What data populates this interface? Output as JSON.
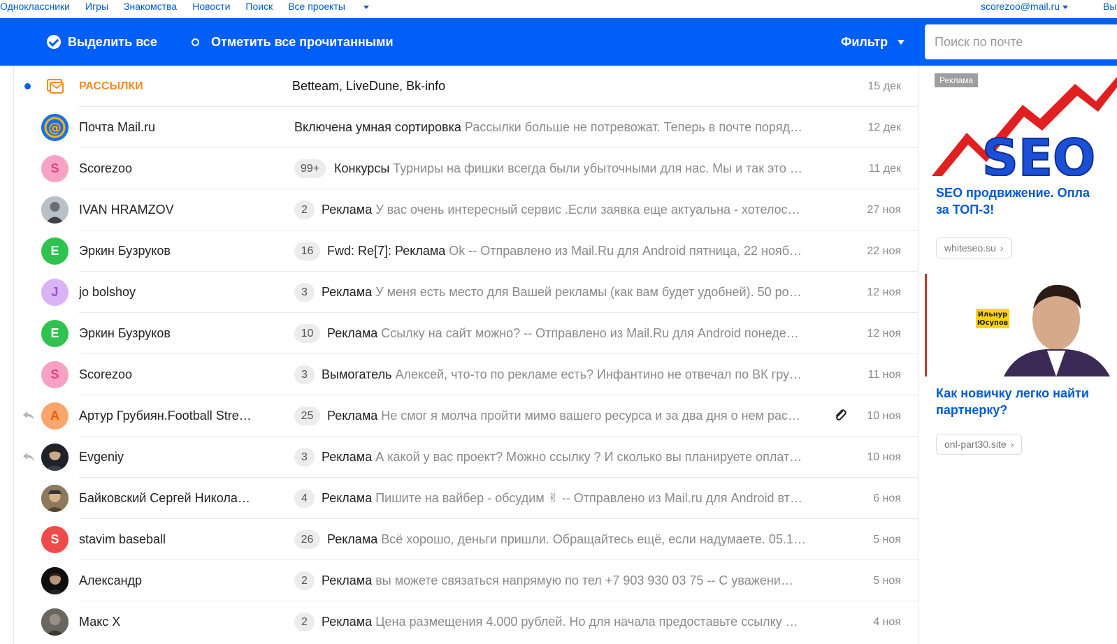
{
  "topnav": {
    "links": [
      "Одноклассники",
      "Игры",
      "Знакомства",
      "Новости",
      "Поиск",
      "Все проекты"
    ],
    "account": "scorezoo@mail.ru",
    "exit": "Выход"
  },
  "toolbar": {
    "select_all": "Выделить все",
    "mark_read": "Отметить все прочитанными",
    "filter": "Фильтр",
    "search_placeholder": "Поиск по почте"
  },
  "messages": [
    {
      "sender": "РАССЫЛКИ",
      "subject": "Betteam, LiveDune, Bk-info",
      "preview": "",
      "date": "15 дек",
      "count": "",
      "avatar": "mailing-icon"
    },
    {
      "sender": "Почта Mail.ru",
      "subject": "Включена умная сортировка",
      "preview": "Рассылки больше не потревожат. Теперь в почте поряд…",
      "date": "12 дек",
      "count": "",
      "avatar": "@"
    },
    {
      "sender": "Scorezoo",
      "subject": "Конкурсы",
      "preview": "Турниры на фишки всегда были убыточными для нас. Мы и так это …",
      "date": "11 дек",
      "count": "99+",
      "avatar": "S"
    },
    {
      "sender": "IVAN HRAMZOV",
      "subject": "Реклама",
      "preview": "У вас очень интересный сервис .Если заявка еще актуальна - хотелос…",
      "date": "27 ноя",
      "count": "2",
      "avatar": ""
    },
    {
      "sender": "Эркин Бузруков",
      "subject": "Fwd: Re[7]: Реклама",
      "preview": "Ok -- Отправлено из Mail.Ru для Android пятница, 22 нояб…",
      "date": "22 ноя",
      "count": "16",
      "avatar": "E"
    },
    {
      "sender": "jo bolshoy",
      "subject": "Реклама",
      "preview": "У меня есть место для Вашей рекламы (как вам будет удобней). 50 ро…",
      "date": "12 ноя",
      "count": "3",
      "avatar": "J"
    },
    {
      "sender": "Эркин Бузруков",
      "subject": "Реклама",
      "preview": "Ссылку на сайт можно? -- Отправлено из Mail.Ru для Android понеде…",
      "date": "12 ноя",
      "count": "10",
      "avatar": "E"
    },
    {
      "sender": "Scorezoo",
      "subject": "Вымогатель",
      "preview": "Алексей, что-то по рекламе есть? Инфантино не отвечал по ВК гру…",
      "date": "11 ноя",
      "count": "3",
      "avatar": "S"
    },
    {
      "sender": "Артур Грубиян.Football Stre…",
      "subject": "Реклама",
      "preview": "Не смог я молча пройти мимо вашего ресурса и за два дня о нем рас…",
      "date": "10 ноя",
      "count": "25",
      "avatar": "A"
    },
    {
      "sender": "Evgeniy",
      "subject": "Реклама",
      "preview": "А какой у вас проект? Можно ссылку ? И сколько вы планируете оплат…",
      "date": "10 ноя",
      "count": "3",
      "avatar": ""
    },
    {
      "sender": "Байковский Сергей Никола…",
      "subject": "Реклама",
      "preview": "Пишите на вайбер - обсудим ✌ -- Отправлено из Mail.ru для Android вт…",
      "date": "6 ноя",
      "count": "4",
      "avatar": ""
    },
    {
      "sender": "stavim baseball",
      "subject": "Реклама",
      "preview": "Всё хорошо, деньги пришли. Обращайтесь ещё, если надумаете. 05.1…",
      "date": "5 ноя",
      "count": "26",
      "avatar": "S"
    },
    {
      "sender": "Александр",
      "subject": "Реклама",
      "preview": "вы можете связаться напрямую по тел +7 903 930 03 75 -- С уважени…",
      "date": "5 ноя",
      "count": "2",
      "avatar": ""
    },
    {
      "sender": "Макс Х",
      "subject": "Реклама",
      "preview": "Цена размещения 4.000 рублей. Но для начала предоставьте ссылку …",
      "date": "4 ноя",
      "count": "2",
      "avatar": ""
    }
  ],
  "ads": [
    {
      "label": "Реклама",
      "image_text": "SEO",
      "title_lines": [
        "SEO продвижение. Опла",
        "за ТОП-3!"
      ],
      "link": "whiteseo.su"
    },
    {
      "image_text_lines": [
        "Ильнур",
        "Юсупов"
      ],
      "title_lines": [
        "Как новичку легко найти",
        "партнерку?"
      ],
      "link": "onl-part30.site"
    }
  ],
  "colors": {
    "accent": "#005ff9",
    "link": "#005bd1",
    "mailing": "#f28c1e"
  }
}
